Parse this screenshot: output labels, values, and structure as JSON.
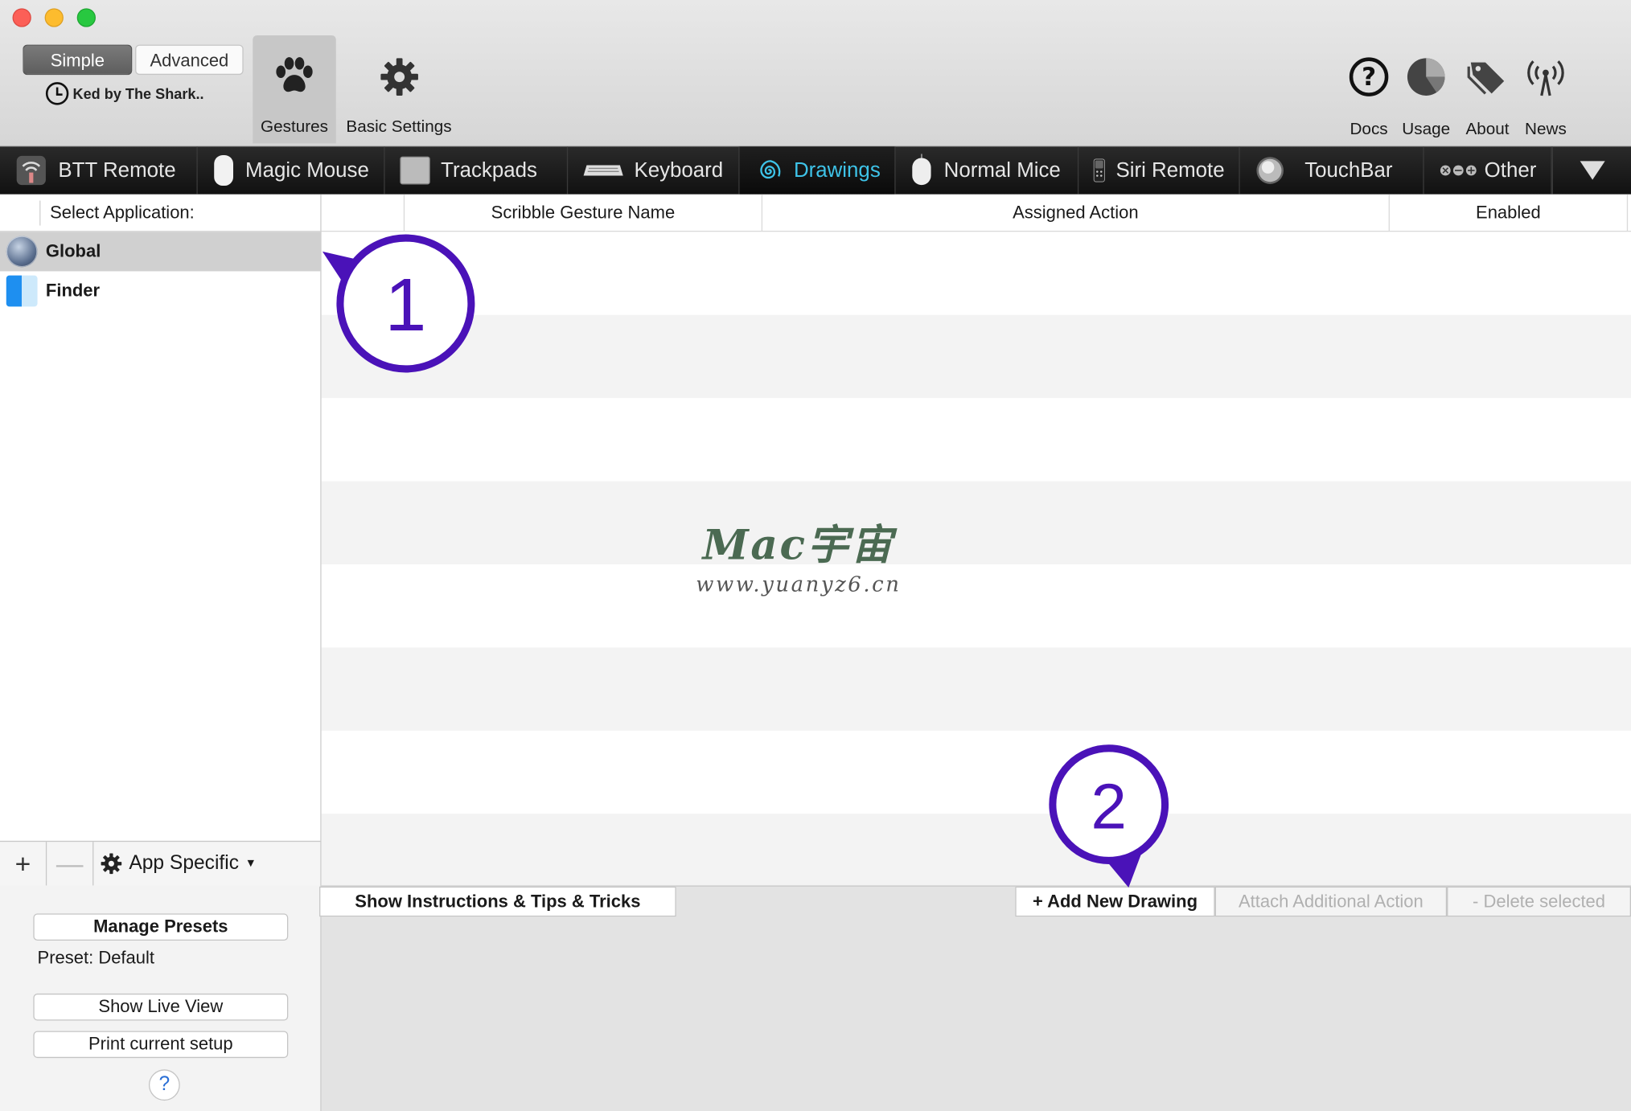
{
  "toolbar": {
    "mode_simple": "Simple",
    "mode_advanced": "Advanced",
    "license_text": "Ked by The Shark..",
    "gestures_label": "Gestures",
    "basic_settings_label": "Basic Settings",
    "docs_label": "Docs",
    "usage_label": "Usage",
    "about_label": "About",
    "news_label": "News"
  },
  "tabs": [
    {
      "label": "BTT Remote",
      "icon": "wifi-remote-icon"
    },
    {
      "label": "Magic Mouse",
      "icon": "magic-mouse-icon"
    },
    {
      "label": "Trackpads",
      "icon": "trackpad-icon"
    },
    {
      "label": "Keyboard",
      "icon": "keyboard-icon"
    },
    {
      "label": "Drawings",
      "icon": "spiral-icon",
      "active": true
    },
    {
      "label": "Normal Mice",
      "icon": "mouse-icon"
    },
    {
      "label": "Siri Remote",
      "icon": "siri-remote-icon"
    },
    {
      "label": "TouchBar",
      "icon": "touchbar-icon"
    },
    {
      "label": "Other",
      "icon": "controls-icon"
    }
  ],
  "sidebar": {
    "header": "Select Application:",
    "apps": [
      {
        "name": "Global",
        "icon": "globe-icon",
        "selected": true
      },
      {
        "name": "Finder",
        "icon": "finder-icon",
        "selected": false
      }
    ],
    "app_specific_label": "App Specific",
    "manage_presets": "Manage Presets",
    "preset_label": "Preset: Default",
    "show_live_view": "Show Live View",
    "print_setup": "Print current setup",
    "help": "?"
  },
  "table": {
    "columns": [
      "Scribble Gesture Name",
      "Assigned Action",
      "Enabled"
    ]
  },
  "watermark": {
    "title": "Mac宇宙",
    "url": "www.yuanyz6.cn"
  },
  "actions": {
    "show_instructions": "Show Instructions & Tips & Tricks",
    "add_new_drawing": "+ Add New Drawing",
    "attach_action": "Attach Additional Action",
    "delete_selected": "- Delete selected"
  },
  "callouts": {
    "one": "1",
    "two": "2",
    "color": "#4a12b8"
  },
  "colors": {
    "active_tab": "#3ec3e8"
  }
}
